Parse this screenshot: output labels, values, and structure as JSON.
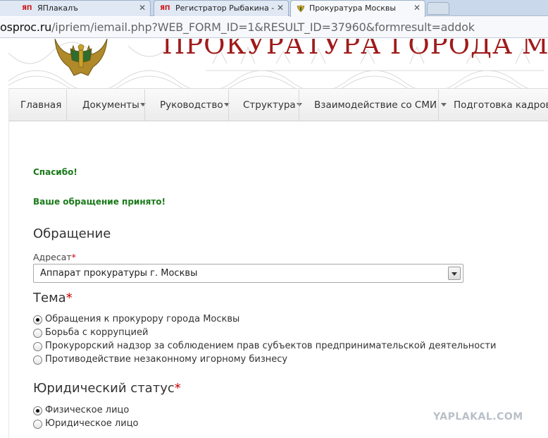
{
  "browser": {
    "tabs": [
      {
        "label": "ЯПлакалъ",
        "favicon": "ЯП"
      },
      {
        "label": "Регистратор Рыбакина -",
        "favicon": "ЯП"
      },
      {
        "label": "Прокуратура Москвы",
        "favicon": "emblem-icon"
      }
    ],
    "address": {
      "host": "osproc.ru",
      "path": "/ipriem/iemail.php?WEB_FORM_ID=1&RESULT_ID=37960&formresult=addok"
    }
  },
  "site": {
    "title": "ПРОКУРАТУРА ГОРОДА МОСКВЫ",
    "colors": {
      "title": "#a01a1a",
      "success": "#1a7a1a",
      "required": "#cc0000"
    }
  },
  "nav": {
    "items": [
      {
        "label": "Главная",
        "dropdown": false
      },
      {
        "label": "Документы",
        "dropdown": true
      },
      {
        "label": "Руководство",
        "dropdown": true
      },
      {
        "label": "Структура",
        "dropdown": true
      },
      {
        "label": "Взаимодействие со СМИ",
        "dropdown": true
      },
      {
        "label": "Подготовка кадров",
        "dropdown": true
      }
    ]
  },
  "form": {
    "thanks": "Спасибо!",
    "accepted": "Ваше обращение принято!",
    "heading": "Обращение",
    "addressee": {
      "label": "Адресат",
      "required_mark": "*",
      "selected": "Аппарат прокуратуры г. Москвы"
    },
    "topic": {
      "label": "Тема",
      "required_mark": "*",
      "options": [
        {
          "label": "Обращения к прокурору города Москвы",
          "checked": true
        },
        {
          "label": "Борьба с коррупцией",
          "checked": false
        },
        {
          "label": "Прокурорский надзор за соблюдением прав субъектов предпринимательской деятельности",
          "checked": false
        },
        {
          "label": "Противодействие незаконному игорному бизнесу",
          "checked": false
        }
      ]
    },
    "legal_status": {
      "label": "Юридический статус",
      "required_mark": "*",
      "options": [
        {
          "label": "Физическое лицо",
          "checked": true
        },
        {
          "label": "Юридическое лицо",
          "checked": false
        }
      ]
    }
  },
  "watermark": "YAPLAKAL.COM"
}
